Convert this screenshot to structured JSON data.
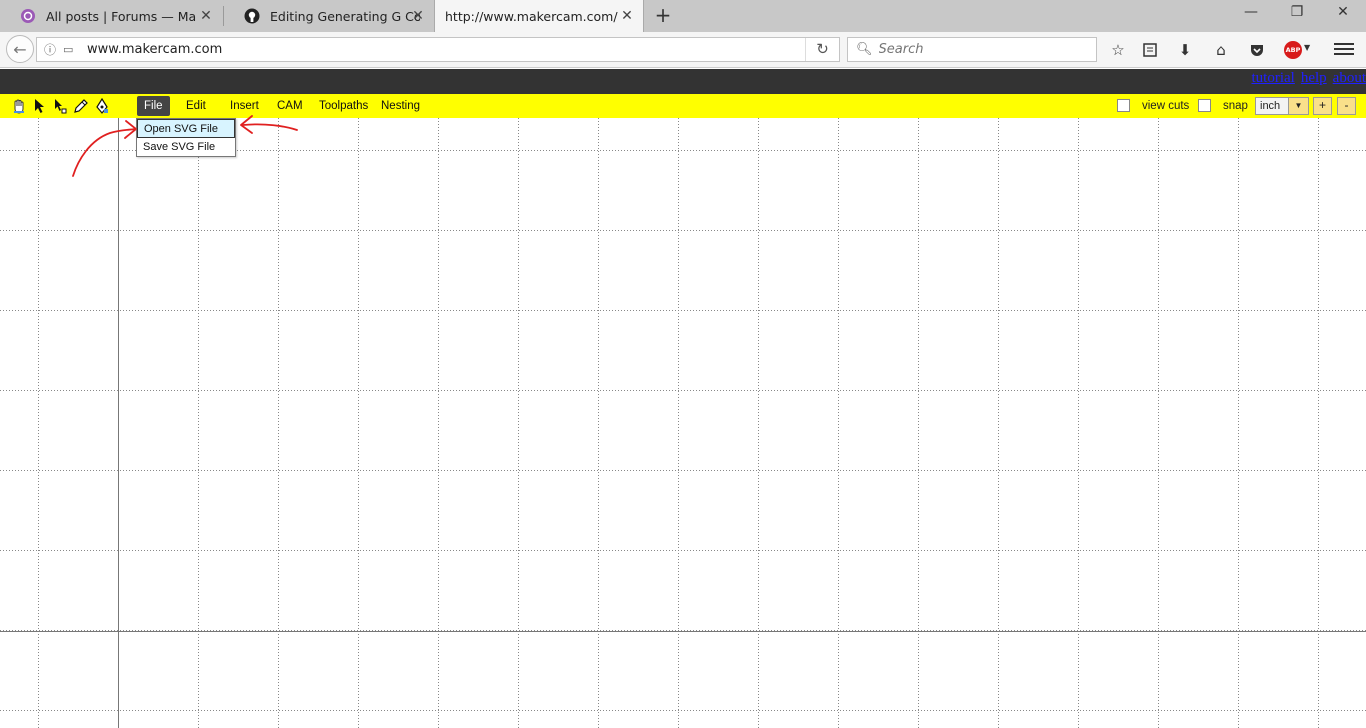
{
  "browser": {
    "tabs": [
      {
        "title": "All posts | Forums — Maslow",
        "active": false
      },
      {
        "title": "Editing Generating G Code U",
        "active": false
      },
      {
        "title": "http://www.makercam.com/",
        "active": true
      }
    ],
    "url": "www.makercam.com",
    "search_placeholder": "Search"
  },
  "app": {
    "top_links": [
      "tutorial",
      "help",
      "about"
    ],
    "menus": [
      "File",
      "Edit",
      "Insert",
      "CAM",
      "Toolpaths",
      "Nesting"
    ],
    "active_menu": "File",
    "file_menu_items": [
      "Open SVG File",
      "Save SVG File"
    ],
    "highlighted_item": "Open SVG File",
    "toggles": {
      "view_cuts": "view cuts",
      "snap": "snap"
    },
    "unit": "inch",
    "zoom_in": "+",
    "zoom_out": "-"
  },
  "colors": {
    "toolbar": "#ffff00",
    "darkbar": "#333333",
    "annotation": "#e02020",
    "link": "#2020ff"
  },
  "icons": [
    "hand-icon",
    "pointer-icon",
    "node-edit-icon",
    "pencil-icon",
    "pen-icon"
  ]
}
